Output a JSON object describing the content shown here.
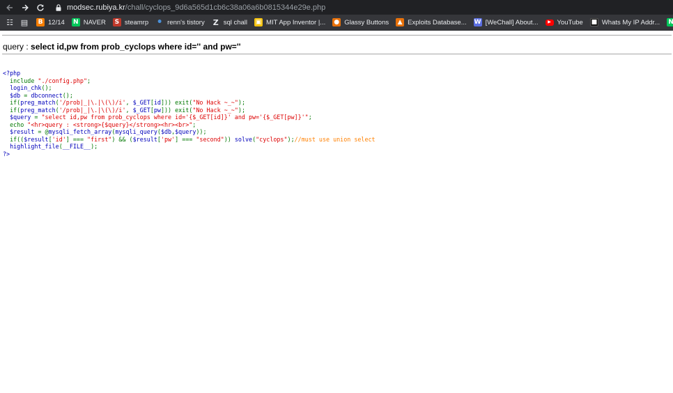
{
  "browser": {
    "url_host": "modsec.rubiya.kr",
    "url_path": "/chall/cyclops_9d6a565d1cb6c38a06a6b0815344e29e.php"
  },
  "bookmarks": [
    {
      "label": "",
      "icon": "apps-grid-icon",
      "color": "#e8eaed"
    },
    {
      "label": "",
      "icon": "bookmark-doc-icon",
      "color": "#e8eaed"
    },
    {
      "label": "12/14",
      "icon": "blogger-icon",
      "color": "#f57d00"
    },
    {
      "label": "NAVER",
      "icon": "naver-icon",
      "color": "#03c75a"
    },
    {
      "label": "steamrp",
      "icon": "steamrp-icon",
      "color": "#c0392b"
    },
    {
      "label": "renn's tistory",
      "icon": "tistory-icon",
      "color": "#4a90d9"
    },
    {
      "label": "sql chall",
      "icon": "z-icon",
      "color": "#e8eaed"
    },
    {
      "label": "MIT App Inventor |...",
      "icon": "app-inventor-icon",
      "color": "#f4c20d"
    },
    {
      "label": "Glassy Buttons",
      "icon": "glassy-buttons-icon",
      "color": "#e8710a"
    },
    {
      "label": "Exploits Database...",
      "icon": "exploit-db-icon",
      "color": "#e8710a"
    },
    {
      "label": "[WeChall] About...",
      "icon": "wechall-icon",
      "color": "#5b6ee1"
    },
    {
      "label": "YouTube",
      "icon": "youtube-icon",
      "color": "#ff0000"
    },
    {
      "label": "Whats My IP Addr...",
      "icon": "whatsmyip-icon",
      "color": "#111111"
    },
    {
      "label": "NAVER",
      "icon": "naver-icon",
      "color": "#03c75a"
    }
  ],
  "page": {
    "query_prefix": "query : ",
    "query_text": "select id,pw from prob_cyclops where id='' and pw=''",
    "source_lines": [
      [
        {
          "t": "<?php",
          "c": "default"
        }
      ],
      [
        {
          "t": "  include ",
          "c": "keyword"
        },
        {
          "t": "\"./config.php\"",
          "c": "string"
        },
        {
          "t": ";",
          "c": "keyword"
        }
      ],
      [
        {
          "t": "  login_chk",
          "c": "default"
        },
        {
          "t": "();",
          "c": "keyword"
        }
      ],
      [
        {
          "t": "  $db ",
          "c": "default"
        },
        {
          "t": "= ",
          "c": "keyword"
        },
        {
          "t": "dbconnect",
          "c": "default"
        },
        {
          "t": "();",
          "c": "keyword"
        }
      ],
      [
        {
          "t": "  if(",
          "c": "keyword"
        },
        {
          "t": "preg_match",
          "c": "default"
        },
        {
          "t": "(",
          "c": "keyword"
        },
        {
          "t": "'/prob|_|\\.|\\(\\)/i'",
          "c": "string"
        },
        {
          "t": ", ",
          "c": "keyword"
        },
        {
          "t": "$_GET",
          "c": "default"
        },
        {
          "t": "[",
          "c": "keyword"
        },
        {
          "t": "id",
          "c": "default"
        },
        {
          "t": "])) exit(",
          "c": "keyword"
        },
        {
          "t": "\"No Hack ~_~\"",
          "c": "string"
        },
        {
          "t": ");",
          "c": "keyword"
        }
      ],
      [
        {
          "t": "  if(",
          "c": "keyword"
        },
        {
          "t": "preg_match",
          "c": "default"
        },
        {
          "t": "(",
          "c": "keyword"
        },
        {
          "t": "'/prob|_|\\.|\\(\\)/i'",
          "c": "string"
        },
        {
          "t": ", ",
          "c": "keyword"
        },
        {
          "t": "$_GET",
          "c": "default"
        },
        {
          "t": "[",
          "c": "keyword"
        },
        {
          "t": "pw",
          "c": "default"
        },
        {
          "t": "])) exit(",
          "c": "keyword"
        },
        {
          "t": "\"No Hack ~_~\"",
          "c": "string"
        },
        {
          "t": ");",
          "c": "keyword"
        }
      ],
      [
        {
          "t": "  $query ",
          "c": "default"
        },
        {
          "t": "= ",
          "c": "keyword"
        },
        {
          "t": "\"select id,pw from prob_cyclops where id='{$_GET[id]}' and pw='{$_GET[pw]}'\"",
          "c": "string"
        },
        {
          "t": ";",
          "c": "keyword"
        }
      ],
      [
        {
          "t": "  echo ",
          "c": "keyword"
        },
        {
          "t": "\"<hr>query : <strong>{$query}</strong><hr><br>\"",
          "c": "string"
        },
        {
          "t": ";",
          "c": "keyword"
        }
      ],
      [
        {
          "t": "  $result ",
          "c": "default"
        },
        {
          "t": "= @",
          "c": "keyword"
        },
        {
          "t": "mysqli_fetch_array",
          "c": "default"
        },
        {
          "t": "(",
          "c": "keyword"
        },
        {
          "t": "mysqli_query",
          "c": "default"
        },
        {
          "t": "(",
          "c": "keyword"
        },
        {
          "t": "$db",
          "c": "default"
        },
        {
          "t": ",",
          "c": "keyword"
        },
        {
          "t": "$query",
          "c": "default"
        },
        {
          "t": "));",
          "c": "keyword"
        }
      ],
      [
        {
          "t": "  if((",
          "c": "keyword"
        },
        {
          "t": "$result",
          "c": "default"
        },
        {
          "t": "[",
          "c": "keyword"
        },
        {
          "t": "'id'",
          "c": "string"
        },
        {
          "t": "] === ",
          "c": "keyword"
        },
        {
          "t": "\"first\"",
          "c": "string"
        },
        {
          "t": ") && (",
          "c": "keyword"
        },
        {
          "t": "$result",
          "c": "default"
        },
        {
          "t": "[",
          "c": "keyword"
        },
        {
          "t": "'pw'",
          "c": "string"
        },
        {
          "t": "] === ",
          "c": "keyword"
        },
        {
          "t": "\"second\"",
          "c": "string"
        },
        {
          "t": ")) ",
          "c": "keyword"
        },
        {
          "t": "solve",
          "c": "default"
        },
        {
          "t": "(",
          "c": "keyword"
        },
        {
          "t": "\"cyclops\"",
          "c": "string"
        },
        {
          "t": ");",
          "c": "keyword"
        },
        {
          "t": "//must use union select",
          "c": "comment"
        }
      ],
      [
        {
          "t": "  highlight_file",
          "c": "default"
        },
        {
          "t": "(",
          "c": "keyword"
        },
        {
          "t": "__FILE__",
          "c": "default"
        },
        {
          "t": ");",
          "c": "keyword"
        }
      ],
      [
        {
          "t": "?>",
          "c": "default"
        }
      ]
    ]
  }
}
